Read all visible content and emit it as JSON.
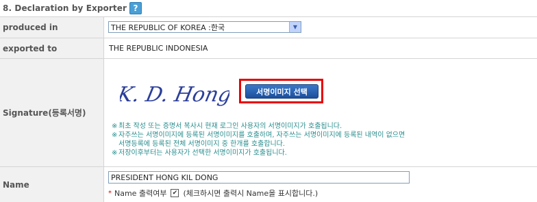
{
  "section": {
    "title": "8. Declaration by Exporter",
    "help_icon": "?"
  },
  "rows": {
    "produced_in": {
      "label": "produced in",
      "selected": "THE REPUBLIC OF KOREA :한국"
    },
    "exported_to": {
      "label": "exported to",
      "value": "THE REPUBLIC INDONESIA"
    },
    "signature": {
      "label": "Signature(등록서명)",
      "signature_text": "K. D. Hong.",
      "button_label": "서명이미지 선택",
      "notes": [
        "최초 작성 또는 증명서 복사시 현재 로그인 사용자의 서명이미지가 호출됩니다.",
        "자주쓰는 서명이미지에 등록된 서명이미지를 호출하며, 자주쓰는 서명이미지에 등록된 내역이 없으면",
        "서명등록에 등록된 전체 서명이미지 중 한개를 호출합니다.",
        "저장이후부터는 사용자가 선택한 서명이미지가 호출됩니다."
      ],
      "note_marker": "※"
    },
    "name": {
      "label": "Name",
      "value": "PRESIDENT HONG KIL DONG",
      "required_marker": "*",
      "option_label": "Name 출력여부",
      "checked_mark": "✔",
      "option_hint": "(체크하시면 출력시 Name을 표시합니다.)"
    }
  }
}
